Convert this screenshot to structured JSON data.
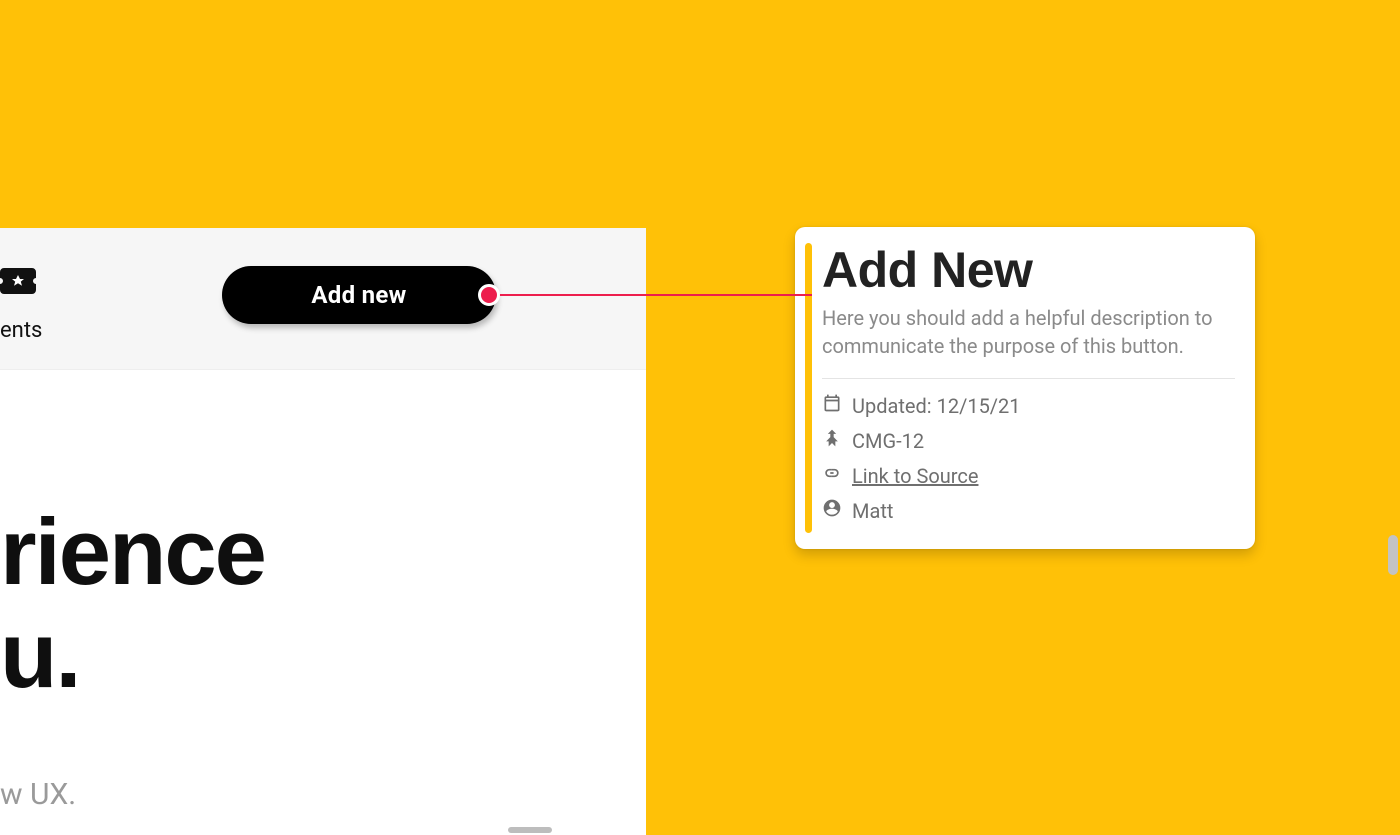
{
  "nav": {
    "tab_label_fragment": "ents",
    "add_new_label": "Add new"
  },
  "hero": {
    "line1_fragment": "rience",
    "line2_fragment": "u.",
    "sub_fragment": "w UX."
  },
  "card": {
    "title": "Add New",
    "description": "Here you should add a helpful description to communicate the purpose of this button.",
    "updated_label": "Updated: 12/15/21",
    "issue_key": "CMG-12",
    "link_label": "Link to Source",
    "owner": "Matt"
  },
  "colors": {
    "background": "#FFC107",
    "connector": "#ED1E4D"
  }
}
